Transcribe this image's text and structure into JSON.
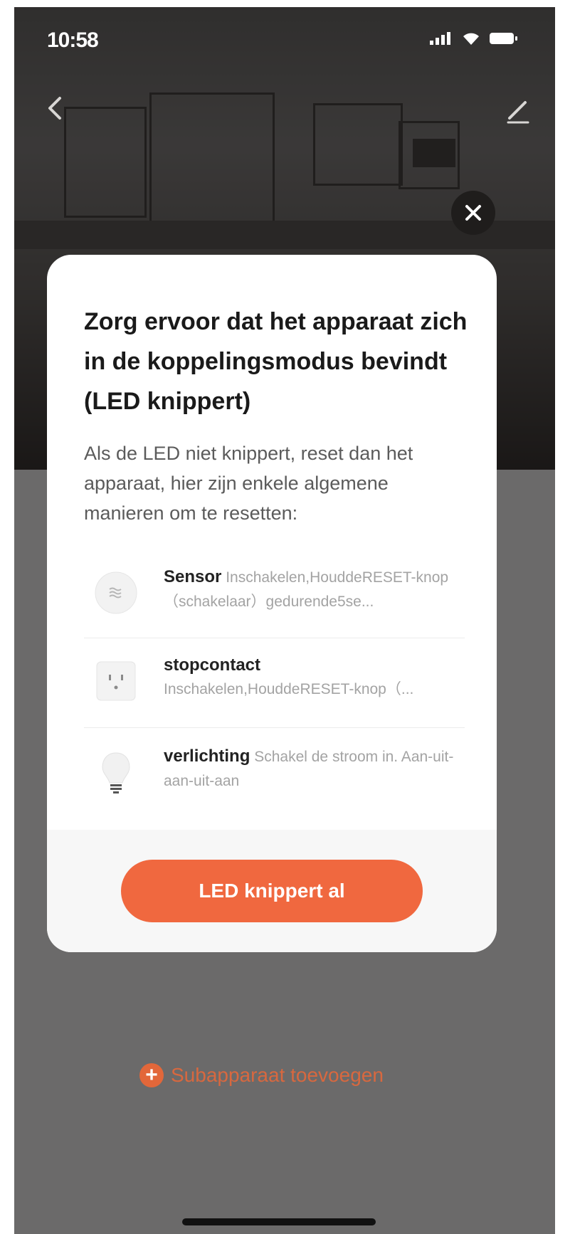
{
  "status_bar": {
    "time": "10:58"
  },
  "modal": {
    "title": "Zorg ervoor dat het apparaat zich in de koppelingsmodus bevindt (LED knippert)",
    "description": "Als de LED niet knippert, reset dan het apparaat, hier zijn enkele algemene manieren om te resetten:",
    "devices": [
      {
        "name": "Sensor",
        "instructions": "Inschakelen,HouddeRESET-knop（schakelaar）gedurende5se...",
        "icon": "sensor-icon"
      },
      {
        "name": "stopcontact",
        "instructions": "Inschakelen,HouddeRESET-knop（...",
        "icon": "socket-icon"
      },
      {
        "name": "verlichting",
        "instructions": "Schakel de stroom in. Aan-uit-aan-uit-aan",
        "icon": "bulb-icon"
      }
    ],
    "confirm_label": "LED knippert al"
  },
  "footer": {
    "add_subdevice_label": "Subapparaat toevoegen"
  },
  "colors": {
    "accent": "#f0683f",
    "overlay": "rgba(0,0,0,0.56)",
    "close_button": "#1f1d1c"
  }
}
